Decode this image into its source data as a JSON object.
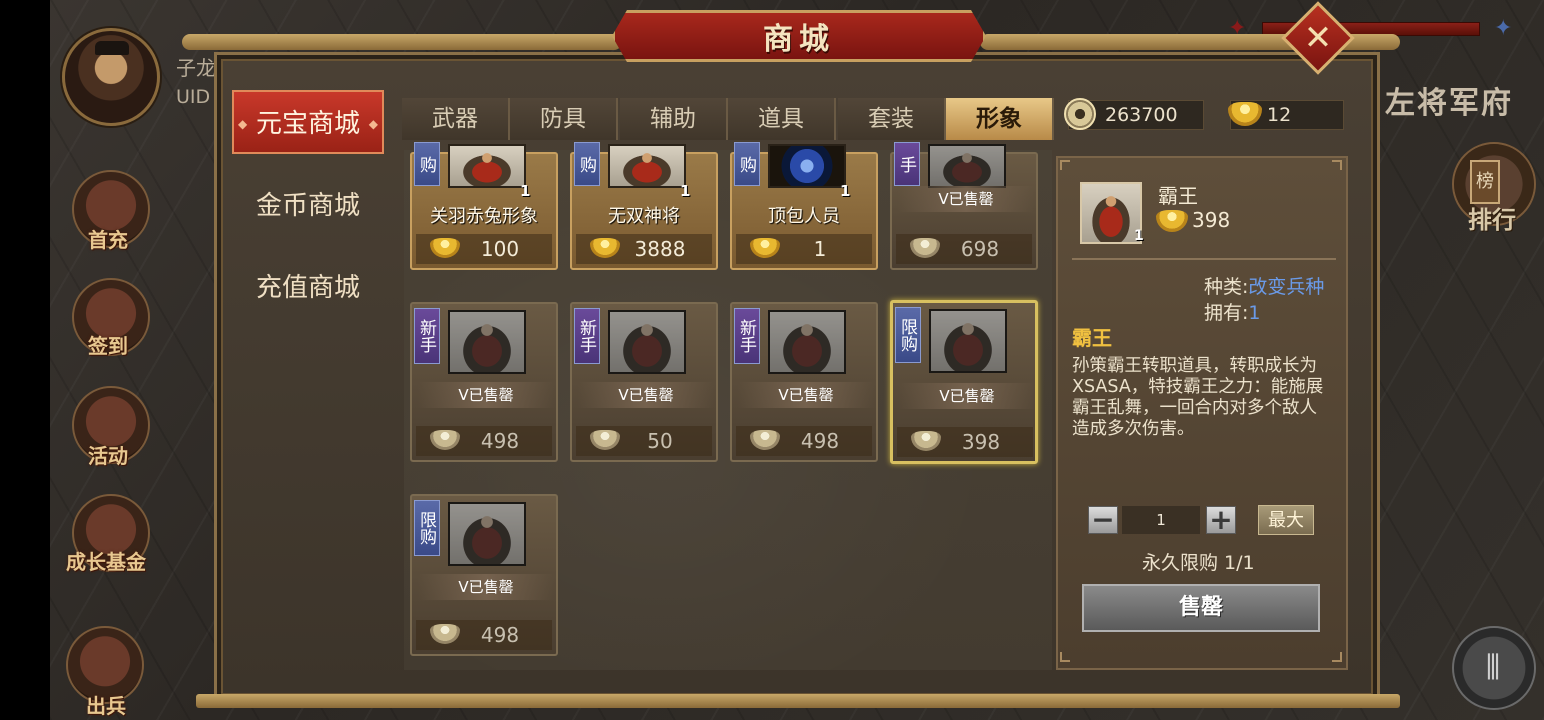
{
  "header": {
    "title": "商城"
  },
  "player": {
    "name": "子龙",
    "uid_label": "UID"
  },
  "side_menu": [
    {
      "label": "首充"
    },
    {
      "label": "签到"
    },
    {
      "label": "活动"
    },
    {
      "label": "成长基金"
    },
    {
      "label": "出兵"
    }
  ],
  "right_area": {
    "title": "左将军府",
    "rank_label": "排行",
    "rank_icon_text": "榜"
  },
  "store_nav": [
    {
      "label": "元宝商城",
      "active": true
    },
    {
      "label": "金币商城",
      "active": false
    },
    {
      "label": "充值商城",
      "active": false
    }
  ],
  "tabs": [
    {
      "label": "武器"
    },
    {
      "label": "防具"
    },
    {
      "label": "辅助"
    },
    {
      "label": "道具"
    },
    {
      "label": "套装"
    },
    {
      "label": "形象",
      "active": true
    }
  ],
  "currency": {
    "coins": "263700",
    "ingots": "12"
  },
  "items": [
    {
      "name": "关羽赤兔形象",
      "tag": "购",
      "qty": "1",
      "price": "100",
      "sold": false
    },
    {
      "name": "无双神将",
      "tag": "购",
      "qty": "1",
      "price": "3888",
      "sold": false
    },
    {
      "name": "顶包人员",
      "tag": "购",
      "qty": "1",
      "price": "1",
      "sold": false
    },
    {
      "name": "",
      "tag": "手",
      "qty": "",
      "price": "698",
      "sold": true,
      "sold_label": "V已售罄"
    },
    {
      "name": "",
      "tag": "新手",
      "qty": "",
      "price": "498",
      "sold": true,
      "sold_label": "V已售罄"
    },
    {
      "name": "",
      "tag": "新手",
      "qty": "",
      "price": "50",
      "sold": true,
      "sold_label": "V已售罄"
    },
    {
      "name": "",
      "tag": "新手",
      "qty": "",
      "price": "498",
      "sold": true,
      "sold_label": "V已售罄"
    },
    {
      "name": "",
      "tag": "限购",
      "qty": "",
      "price": "398",
      "sold": true,
      "sold_label": "V已售罄"
    },
    {
      "name": "",
      "tag": "限购",
      "qty": "",
      "price": "498",
      "sold": true,
      "sold_label": "V已售罄"
    }
  ],
  "detail": {
    "name": "霸王",
    "price": "398",
    "qty": "1",
    "type_label": "种类:",
    "type_value": "改变兵种",
    "own_label": "拥有:",
    "own_value": "1",
    "title": "霸王",
    "description": "孙策霸王转职道具，转职成长为XSASA，特技霸王之力：能施展霸王乱舞，一回合内对多个敌人造成多次伤害。",
    "quantity_value": "1",
    "max_label": "最大",
    "limit_text": "永久限购 1/1",
    "action_label": "售罄"
  },
  "colors": {
    "accent_red": "#c8382a",
    "gold": "#e8c888",
    "link_blue": "#6a9ae8",
    "highlight_yellow": "#f0c040"
  }
}
